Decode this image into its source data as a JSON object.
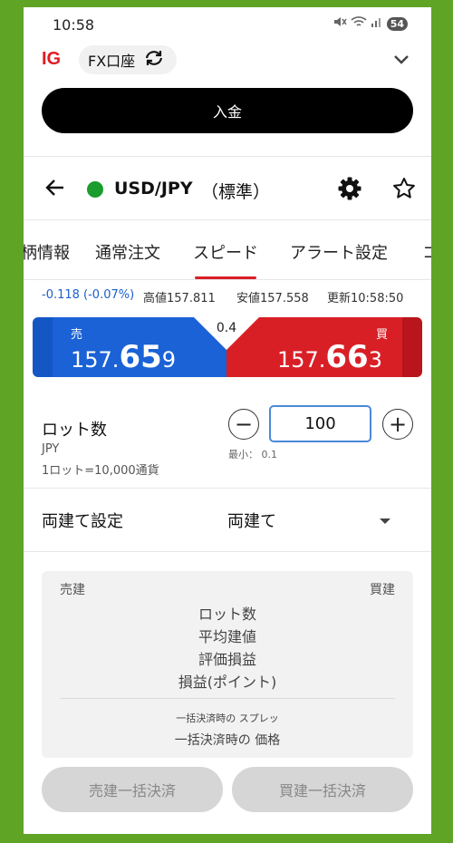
{
  "status": {
    "time": "10:58",
    "battery": "54"
  },
  "header": {
    "logo": "IG",
    "account": "FX口座",
    "deposit_label": "入金"
  },
  "instrument": {
    "symbol": "USD/JPY",
    "type": "（標準）"
  },
  "tabs": [
    {
      "label": "柄情報"
    },
    {
      "label": "通常注文"
    },
    {
      "label": "スピード"
    },
    {
      "label": "アラート設定"
    },
    {
      "label": "コ"
    }
  ],
  "market": {
    "change": "-0.118 (-0.07%)",
    "high": "高値157.811",
    "low": "安値157.558",
    "updated": "更新10:58:50"
  },
  "quote": {
    "sell_label": "売",
    "sell_prefix": "157.",
    "sell_big": "65",
    "sell_suffix": "9",
    "buy_label": "買",
    "buy_prefix": "157.",
    "buy_big": "66",
    "buy_suffix": "3",
    "spread": "0.4"
  },
  "lot": {
    "title": "ロット数",
    "currency": "JPY",
    "unit_note": "1ロット=10,000通貨",
    "value": "100",
    "min_note": "最小： 0.1",
    "minus": "−",
    "plus": "+"
  },
  "hedge": {
    "label": "両建て設定",
    "value": "両建て"
  },
  "positions": {
    "sell_header": "売建",
    "buy_header": "買建",
    "rows": [
      "ロット数",
      "平均建値",
      "評価損益",
      "損益(ポイント)"
    ],
    "spread_note": "一括決済時の スプレッ",
    "price_note": "一括決済時の 価格"
  },
  "actions": {
    "close_sell": "売建一括決済",
    "close_buy": "買建一括決済"
  }
}
